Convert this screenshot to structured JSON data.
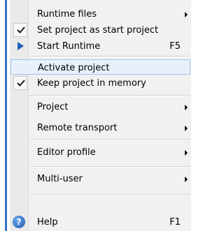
{
  "menu": {
    "items": [
      {
        "label": "Runtime files",
        "shortcut": "",
        "has_submenu": true
      },
      {
        "label": "Set project as start project",
        "shortcut": "",
        "has_submenu": false,
        "checked": true
      },
      {
        "label": "Start Runtime",
        "shortcut": "F5",
        "has_submenu": false,
        "icon": "play-arrow-icon"
      },
      {
        "label": "Activate project",
        "shortcut": "",
        "has_submenu": false,
        "highlighted": true
      },
      {
        "label": "Keep project in memory",
        "shortcut": "",
        "has_submenu": false,
        "checked": true
      },
      {
        "label": "Project",
        "shortcut": "",
        "has_submenu": true
      },
      {
        "label": "Remote transport",
        "shortcut": "",
        "has_submenu": true
      },
      {
        "label": "Editor profile",
        "shortcut": "",
        "has_submenu": true
      },
      {
        "label": "Multi-user",
        "shortcut": "",
        "has_submenu": true
      },
      {
        "label": "Help",
        "shortcut": "F1",
        "has_submenu": false,
        "icon": "help-icon"
      }
    ]
  },
  "icons": {
    "help_glyph": "?",
    "check_color": "#1a1a1a",
    "play_color": "#1d5fb8"
  }
}
